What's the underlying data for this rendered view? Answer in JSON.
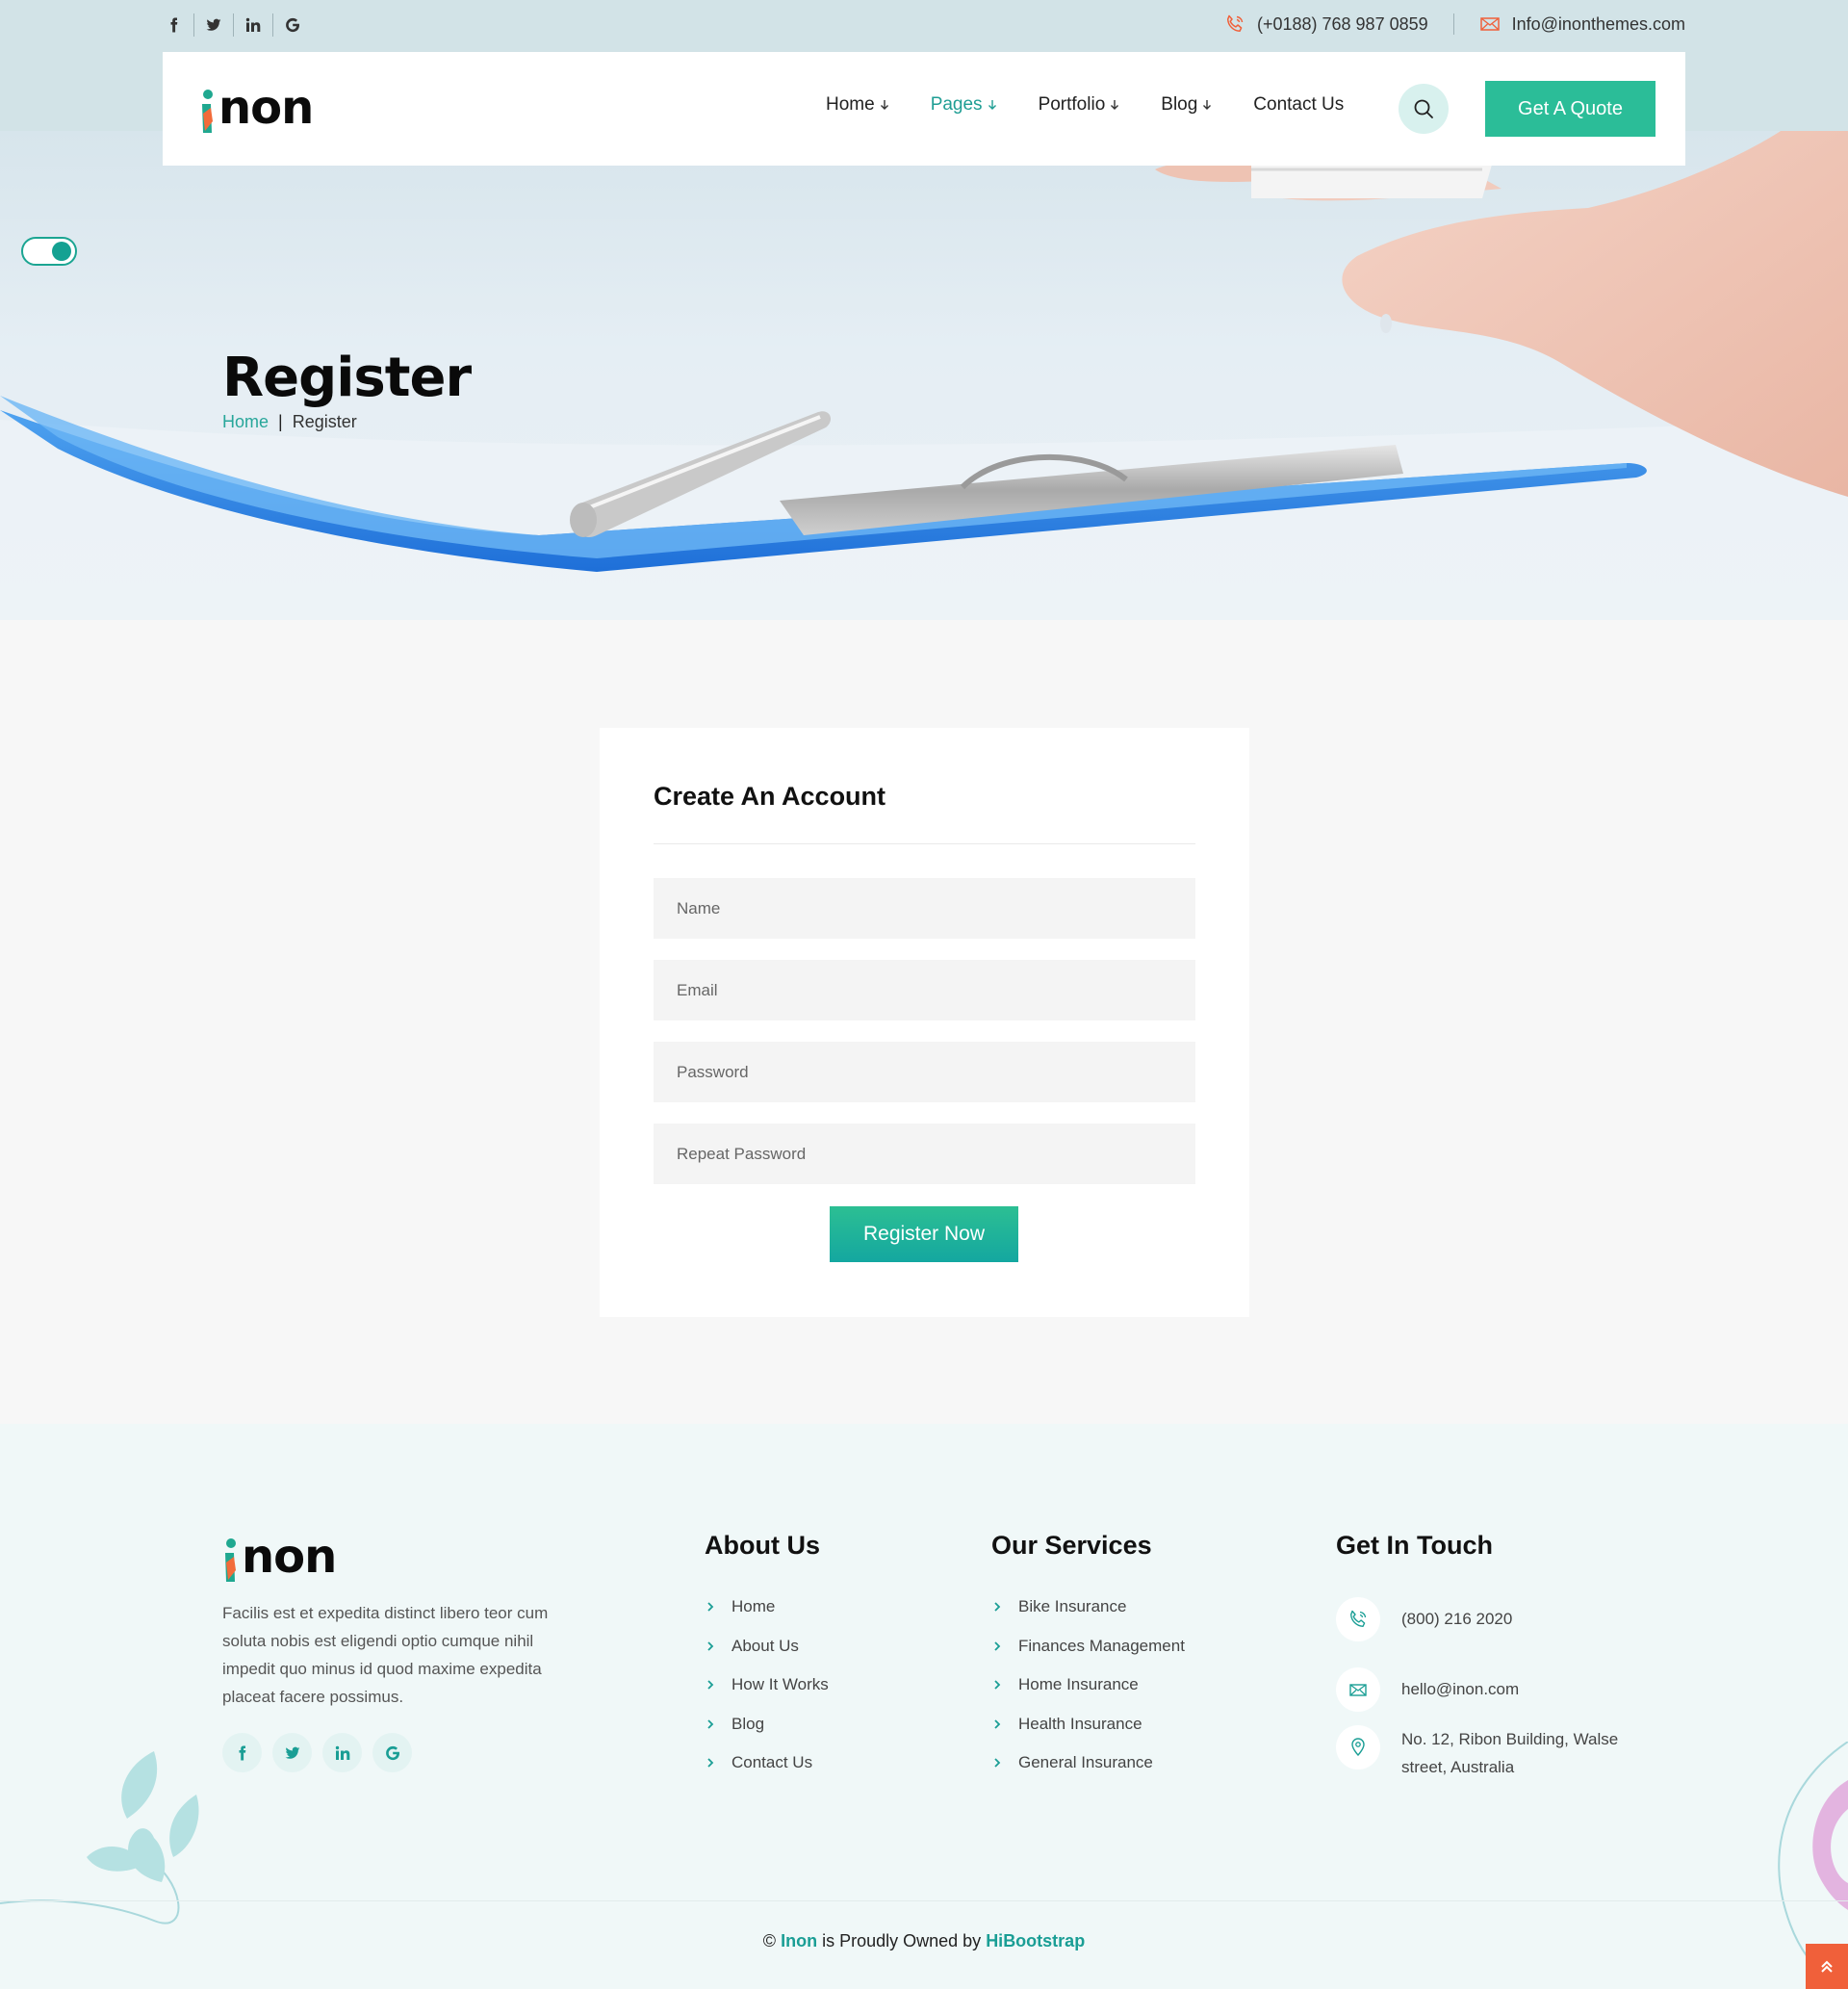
{
  "topbar": {
    "social": [
      {
        "icon": "facebook-icon",
        "glyph": "f"
      },
      {
        "icon": "twitter-icon",
        "glyph": "t"
      },
      {
        "icon": "linkedin-icon",
        "glyph": "in"
      },
      {
        "icon": "google-icon",
        "glyph": "G"
      }
    ],
    "phone": "(+0188) 768 987 0859",
    "email": "Info@inonthemes.com"
  },
  "header": {
    "logo_text": "non",
    "nav": [
      {
        "label": "Home",
        "dropdown": true
      },
      {
        "label": "Pages",
        "dropdown": true,
        "active": true
      },
      {
        "label": "Portfolio",
        "dropdown": true
      },
      {
        "label": "Blog",
        "dropdown": true
      },
      {
        "label": "Contact Us",
        "dropdown": false
      }
    ],
    "quote_label": "Get A Quote"
  },
  "hero": {
    "title": "Register",
    "breadcrumb": {
      "home": "Home",
      "separator": "|",
      "current": "Register"
    }
  },
  "form": {
    "title": "Create An Account",
    "fields": {
      "name": "Name",
      "email": "Email",
      "password": "Password",
      "repeat_password": "Repeat Password"
    },
    "submit_label": "Register Now"
  },
  "footer": {
    "logo_text": "non",
    "description": "Facilis est et expedita distinct libero teor cum soluta nobis est eligendi optio cumque nihil impedit quo minus id quod maxime expedita placeat facere possimus.",
    "about": {
      "title": "About Us",
      "links": [
        "Home",
        "About Us",
        "How It Works",
        "Blog",
        "Contact Us"
      ]
    },
    "services": {
      "title": "Our Services",
      "links": [
        "Bike Insurance",
        "Finances Management",
        "Home Insurance",
        "Health Insurance",
        "General Insurance"
      ]
    },
    "touch": {
      "title": "Get In Touch",
      "phone": "(800) 216 2020",
      "email": "hello@inon.com",
      "address": "No. 12, Ribon Building, Walse street, Australia"
    },
    "copyright": {
      "prefix": "©",
      "brand": "Inon",
      "middle": "is Proudly Owned by",
      "owner": "HiBootstrap"
    }
  },
  "colors": {
    "accent": "#27a69a",
    "button": "#2bbd98",
    "logo_green": "#1fa890",
    "logo_orange": "#f26b3a",
    "back_to_top": "#f0603a"
  }
}
